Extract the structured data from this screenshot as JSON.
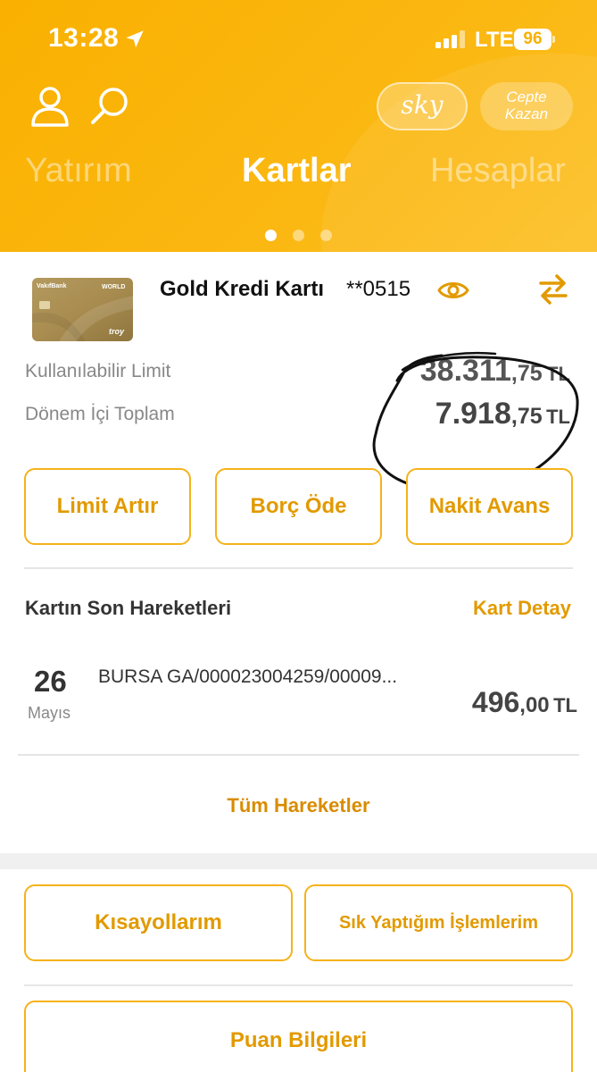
{
  "status_bar": {
    "time": "13:28",
    "network": "LTE",
    "battery": "96"
  },
  "header": {
    "sky_label": "sky",
    "cepte_line1": "Cepte",
    "cepte_line2": "Kazan",
    "tabs": [
      {
        "label": "Yatırım"
      },
      {
        "label": "Kartlar"
      },
      {
        "label": "Hesaplar"
      }
    ],
    "active_tab_index": 1
  },
  "card": {
    "bank_name": "VakıfBank",
    "card_tier": "WORLD",
    "card_brand": "troy",
    "title": "Gold Kredi Kartı",
    "number_masked": "**0515",
    "available_limit_label": "Kullanılabilir Limit",
    "available_limit_int": "38.311",
    "available_limit_dec": ",75",
    "period_total_label": "Dönem İçi Toplam",
    "period_total_int": "7.918",
    "period_total_dec": ",75",
    "currency": "TL"
  },
  "actions": {
    "limit_increase": "Limit Artır",
    "pay_debt": "Borç Öde",
    "cash_advance": "Nakit Avans"
  },
  "transactions": {
    "section_title": "Kartın Son Hareketleri",
    "detail_link": "Kart Detay",
    "items": [
      {
        "day": "26",
        "month": "Mayıs",
        "description": "BURSA GA/000023004259/00009...",
        "amount_int": "496",
        "amount_dec": ",00",
        "currency": "TL"
      }
    ],
    "all_link": "Tüm Hareketler"
  },
  "shortcuts": {
    "my_shortcuts": "Kısayollarım",
    "frequent_ops": "Sık Yaptığım İşlemlerim",
    "points_info": "Puan Bilgileri"
  },
  "colors": {
    "header_yellow": "#f9b000",
    "accent_orange": "#e29a00",
    "button_border": "#f5b21a"
  },
  "icons": [
    "location-arrow-icon",
    "signal-icon",
    "user-icon",
    "search-icon",
    "eye-icon",
    "swap-icon",
    "card-chip-icon"
  ]
}
